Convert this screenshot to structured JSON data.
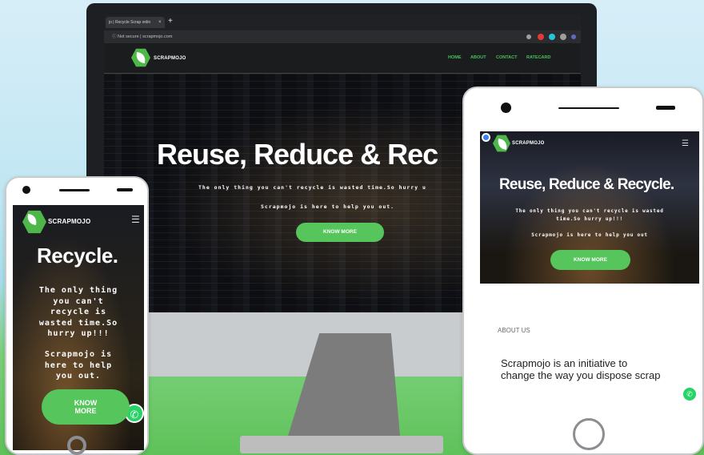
{
  "desktop": {
    "browser": {
      "tab_title": "jo | Recycle Scrap onlin",
      "tab_close": "×",
      "new_tab": "+",
      "address": "ⓘ  Not secure  |  scrapmojo.com"
    },
    "nav": {
      "logo_text": "SCRAPMOJO",
      "links": [
        "HOME",
        "ABOUT",
        "CONTACT",
        "RATECARD"
      ]
    },
    "hero": {
      "title": "Reuse, Reduce & Rec",
      "line1": "The only thing you can't recycle is wasted time.So hurry u",
      "line2": "Scrapmojo is here to help you out.",
      "button": "KNOW MORE"
    }
  },
  "phone_small": {
    "logo_text": "SCRAPMOJO",
    "menu": "☰",
    "title": "Recycle.",
    "lines": [
      "The only thing",
      "you can't",
      "recycle is",
      "wasted time.So",
      "hurry up!!!"
    ],
    "lines2": [
      "Scrapmojo is",
      "here to help",
      "you out."
    ],
    "button_l1": "KNOW",
    "button_l2": "MORE",
    "whatsapp": "✆"
  },
  "phone_large": {
    "logo_text": "SCRAPMOJO",
    "menu": "☰",
    "title": "Reuse, Reduce & Recycle.",
    "line1a": "The only thing you can't recycle is wasted",
    "line1b": "time.So hurry up!!!",
    "line2": "Scrapmojo is here to help you out",
    "button": "KNOW MORE",
    "about_label": "ABOUT US",
    "about_text1": "Scrapmojo is an initiative to",
    "about_text2": "change the way you dispose scrap",
    "whatsapp": "✆"
  },
  "colors": {
    "accent_green": "#55c55c",
    "nav_green": "#46c15b",
    "whatsapp": "#25d366"
  }
}
